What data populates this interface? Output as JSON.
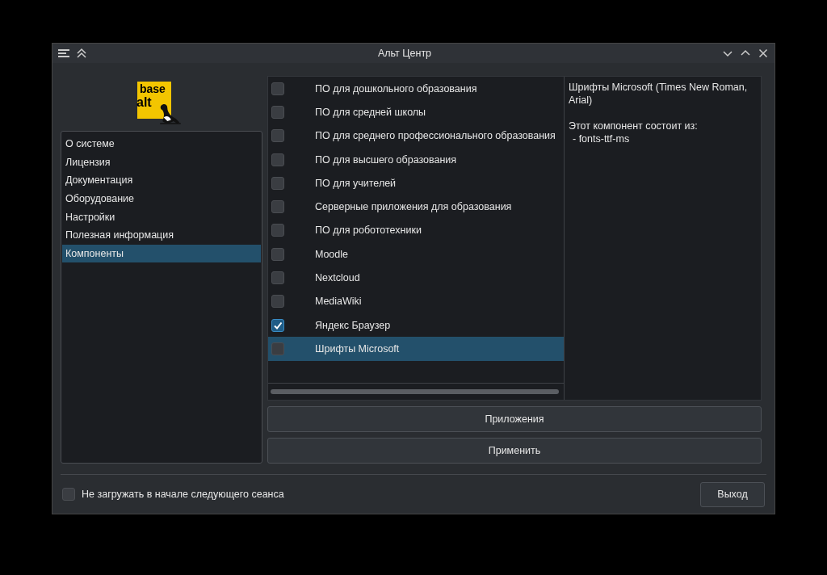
{
  "window": {
    "title": "Альт Центр"
  },
  "logo": {
    "line_1": "base",
    "line_2": "alt"
  },
  "sidebar": {
    "items": [
      {
        "label": "О системе",
        "selected": false
      },
      {
        "label": "Лицензия",
        "selected": false
      },
      {
        "label": "Документация",
        "selected": false
      },
      {
        "label": "Оборудование",
        "selected": false
      },
      {
        "label": "Настройки",
        "selected": false
      },
      {
        "label": "Полезная информация",
        "selected": false
      },
      {
        "label": "Компоненты",
        "selected": true
      }
    ]
  },
  "components": [
    {
      "label": "ПО для дошкольного образования",
      "checked": false,
      "selected": false
    },
    {
      "label": "ПО для средней школы",
      "checked": false,
      "selected": false
    },
    {
      "label": "ПО для среднего профессионального образования",
      "checked": false,
      "selected": false
    },
    {
      "label": "ПО для высшего образования",
      "checked": false,
      "selected": false
    },
    {
      "label": "ПО для учителей",
      "checked": false,
      "selected": false
    },
    {
      "label": "Серверные приложения для образования",
      "checked": false,
      "selected": false
    },
    {
      "label": "ПО для робототехники",
      "checked": false,
      "selected": false
    },
    {
      "label": "Moodle",
      "checked": false,
      "selected": false
    },
    {
      "label": "Nextcloud",
      "checked": false,
      "selected": false
    },
    {
      "label": "MediaWiki",
      "checked": false,
      "selected": false
    },
    {
      "label": "Яндекс Браузер",
      "checked": true,
      "selected": false
    },
    {
      "label": "Шрифты Microsoft",
      "checked": false,
      "selected": true
    }
  ],
  "description": {
    "title": "Шрифты Microsoft (Times New Roman, Arial)",
    "intro": "Этот компонент состоит из:",
    "packages": [
      "- fonts-ttf-ms"
    ]
  },
  "buttons": [
    "Приложения",
    "Применить"
  ],
  "footer": {
    "checkbox": {
      "label": "Не загружать в начале следующего сеанса",
      "checked": false
    },
    "exit_button": "Выход"
  }
}
